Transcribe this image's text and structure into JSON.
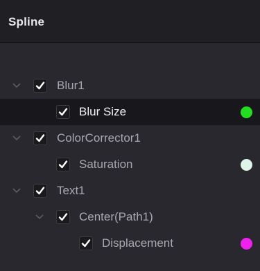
{
  "panel": {
    "title": "Spline"
  },
  "tree": {
    "rows": [
      {
        "label": "Blur1",
        "checked": true,
        "expanded": true,
        "selected": false
      },
      {
        "label": "Blur Size",
        "checked": true,
        "selected": true,
        "color": "#22dd22"
      },
      {
        "label": "ColorCorrector1",
        "checked": true,
        "expanded": true,
        "selected": false
      },
      {
        "label": "Saturation",
        "checked": true,
        "selected": false,
        "color": "#dff5ea"
      },
      {
        "label": "Text1",
        "checked": true,
        "expanded": true,
        "selected": false
      },
      {
        "label": "Center(Path1)",
        "checked": true,
        "expanded": true,
        "selected": false
      },
      {
        "label": "Displacement",
        "checked": true,
        "selected": false,
        "color": "#ee22ee"
      }
    ]
  },
  "icons": {
    "expand": "chevron-down-icon",
    "check": "checkmark-icon"
  }
}
